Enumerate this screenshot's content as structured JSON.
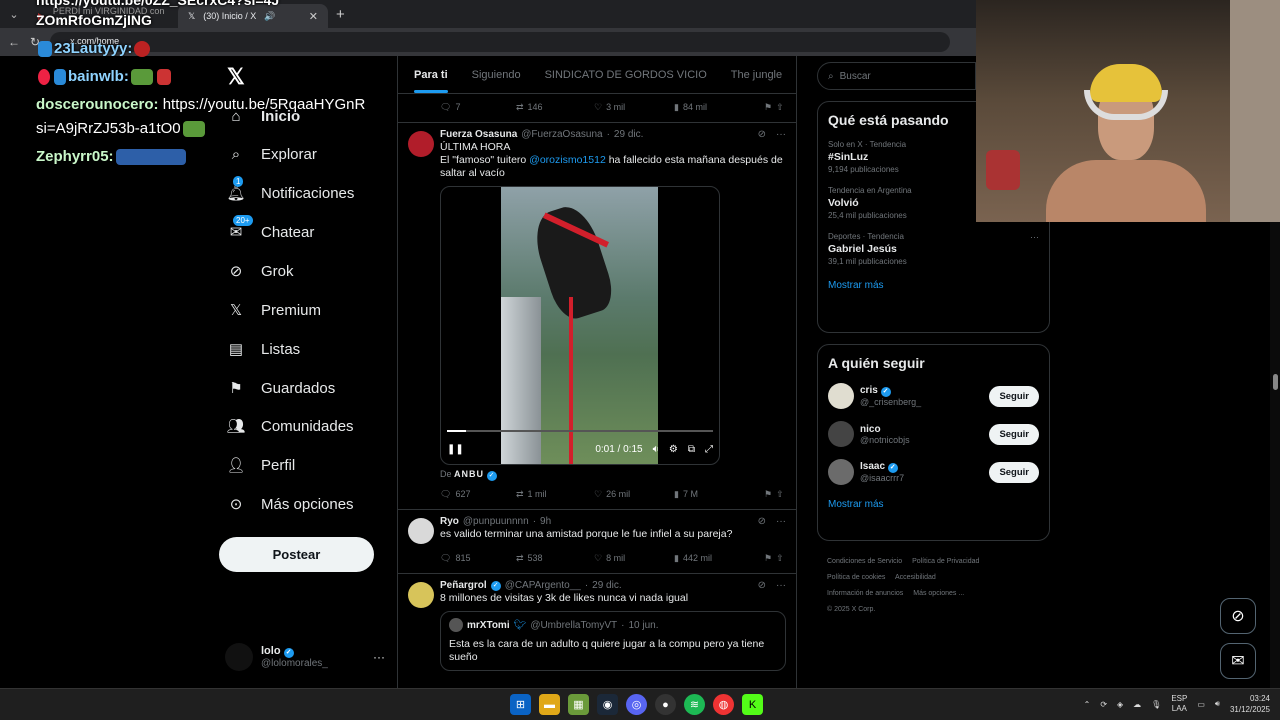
{
  "browser": {
    "tabs": [
      {
        "title": "PERDÍ mi VIRGINIDAD con mi..."
      },
      {
        "title": "(30) Inicio / X"
      }
    ],
    "new_tab": "+",
    "url": "x.com/home"
  },
  "leftnav": {
    "items": [
      {
        "label": "Inicio",
        "icon": "home-icon"
      },
      {
        "label": "Explorar",
        "icon": "search-icon"
      },
      {
        "label": "Notificaciones",
        "icon": "bell-icon",
        "badge": "1"
      },
      {
        "label": "Chatear",
        "icon": "mail-icon",
        "badge": "20+"
      },
      {
        "label": "Grok",
        "icon": "grok-icon"
      },
      {
        "label": "Premium",
        "icon": "x-icon"
      },
      {
        "label": "Listas",
        "icon": "list-icon"
      },
      {
        "label": "Guardados",
        "icon": "bookmark-icon"
      },
      {
        "label": "Comunidades",
        "icon": "people-icon"
      },
      {
        "label": "Perfil",
        "icon": "person-icon"
      },
      {
        "label": "Más opciones",
        "icon": "more-icon"
      }
    ],
    "post_button": "Postear",
    "account": {
      "name": "lolo",
      "handle": "@lolomorales_"
    }
  },
  "feed": {
    "tabs": [
      "Para ti",
      "Siguiendo",
      "SINDICATO DE GORDOS VICIO",
      "The jungle"
    ],
    "prev_actions": {
      "replies": "7",
      "reposts": "146",
      "likes": "3 mil",
      "views": "84 mil"
    },
    "tweets": [
      {
        "name": "Fuerza Osasuna",
        "handle": "@FuerzaOsasuna",
        "date": "29 dic.",
        "line1": "ÚLTIMA HORA",
        "line2_pre": "El \"famoso\" tuitero ",
        "mention": "@orozismo1512",
        "line2_post": " ha fallecido esta mañana después de saltar al vacío",
        "video_time": "0:01 / 0:15",
        "video_progress": 0.07,
        "credit_pre": "De",
        "credit_name": "ANBU",
        "actions": {
          "replies": "627",
          "reposts": "1 mil",
          "likes": "26 mil",
          "views": "7 M"
        }
      },
      {
        "name": "Ryo",
        "handle": "@punpuunnnn",
        "date": "9h",
        "text": "es valido terminar una amistad porque le fue infiel a su pareja?",
        "actions": {
          "replies": "815",
          "reposts": "538",
          "likes": "8 mil",
          "views": "442 mil"
        }
      },
      {
        "name": "Peñargrol",
        "handle": "@CAPArgento__",
        "date": "29 dic.",
        "text": "8 millones de visitas y 3k de likes nunca vi nada igual",
        "quote": {
          "name": "mrXTomi",
          "handle": "@UmbrellaTomyVT",
          "date": "10 jun.",
          "text": "Esta es la cara de un adulto q quiere jugar a la compu pero ya tiene sueño"
        }
      }
    ]
  },
  "sidebar": {
    "search_placeholder": "Buscar",
    "trends_title": "Qué está pasando",
    "trends": [
      {
        "category": "Solo en X · Tendencia",
        "title": "#SinLuz",
        "count": "9,194 publicaciones"
      },
      {
        "category": "Tendencia en Argentina",
        "title": "Volvió",
        "count": "25,4 mil publicaciones"
      },
      {
        "category": "Deportes · Tendencia",
        "title": "Gabriel Jesús",
        "count": "39,1 mil publicaciones"
      }
    ],
    "show_more": "Mostrar más",
    "follow_title": "A quién seguir",
    "follow": [
      {
        "name": "cris",
        "handle": "@_crisenberg_",
        "button": "Seguir",
        "verified": true
      },
      {
        "name": "nico",
        "handle": "@notnicobjs",
        "button": "Seguir",
        "verified": false
      },
      {
        "name": "Isaac",
        "handle": "@isaacrrr7",
        "button": "Seguir",
        "verified": true
      }
    ],
    "footer": [
      "Condiciones de Servicio",
      "Política de Privacidad",
      "Política de cookies",
      "Accesibilidad",
      "Información de anuncios",
      "Más opciones ...",
      "© 2025 X Corp."
    ]
  },
  "chat": {
    "top_line": "https://youtu.be/0ZZ_SEcrxC4?si=4J",
    "line0": "ZOmRfoGmZjING",
    "line1_user": "23Lautyyy:",
    "line2_user": "bainwlb:",
    "line3_user": "doscerounocero:",
    "line3_msg": "https://youtu.be/5RqaaHYGnR",
    "line4_msg": "si=A9jRrZJ53b-a1tO0",
    "line5_user": "Zephyrr05:"
  },
  "taskbar": {
    "lang": "ESP",
    "lang2": "LAA",
    "time": "03:24",
    "date": "31/12/2025"
  },
  "colors": {
    "accent": "#1d9bf0",
    "background": "#000000",
    "border": "#2f3336"
  }
}
